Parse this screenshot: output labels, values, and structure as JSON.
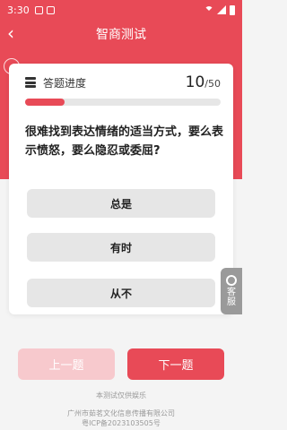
{
  "status_bar": {
    "time": "3:30"
  },
  "header": {
    "title": "智商测试"
  },
  "progress": {
    "label": "答题进度",
    "current": "10",
    "total": "/50",
    "fraction": 0.2
  },
  "question": {
    "text": "很难找到表达情绪的适当方式，要么表示愤怒，要么隐忍或委屈?"
  },
  "options": [
    {
      "label": "总是"
    },
    {
      "label": "有时"
    },
    {
      "label": "从不"
    }
  ],
  "service": {
    "label": "客服"
  },
  "buttons": {
    "prev": "上一题",
    "next": "下一题"
  },
  "footer": {
    "note": "本测试仅供娱乐",
    "company": "广州市茹茗文化信息传播有限公司",
    "icp": "粤ICP备2023103505号"
  },
  "colors": {
    "brand": "#e84a57",
    "prev_button": "#f7c9cd",
    "option_bg": "#e6e6e6"
  }
}
